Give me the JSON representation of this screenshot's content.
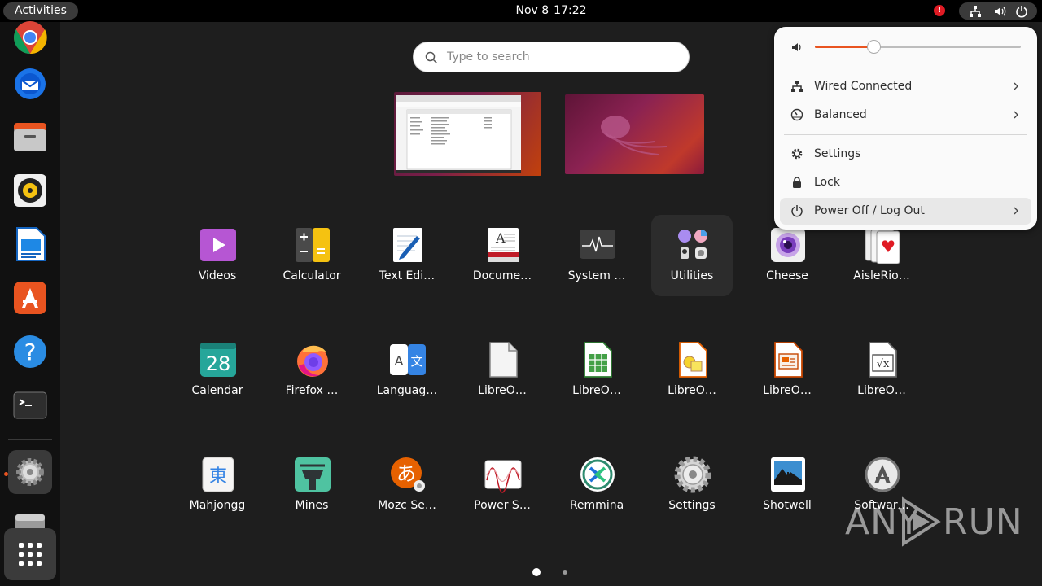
{
  "topbar": {
    "activities_label": "Activities",
    "date": "Nov 8",
    "time": "17:22",
    "notification_badge": "!"
  },
  "search": {
    "placeholder": "Type to search"
  },
  "apps": [
    {
      "name": "videos",
      "label": "Videos",
      "icon": "videos-icon"
    },
    {
      "name": "calculator",
      "label": "Calculator",
      "icon": "calculator-icon"
    },
    {
      "name": "text-editor",
      "label": "Text Edi…",
      "icon": "text-editor-icon"
    },
    {
      "name": "document-viewer",
      "label": "Docume…",
      "icon": "document-viewer-icon"
    },
    {
      "name": "system-monitor",
      "label": "System …",
      "icon": "system-monitor-icon"
    },
    {
      "name": "utilities",
      "label": "Utilities",
      "icon": "utilities-folder-icon",
      "selected": true
    },
    {
      "name": "cheese",
      "label": "Cheese",
      "icon": "cheese-icon"
    },
    {
      "name": "aisleriot",
      "label": "AisleRio…",
      "icon": "cards-icon"
    },
    {
      "name": "calendar",
      "label": "Calendar",
      "icon": "calendar-icon",
      "badge": "28"
    },
    {
      "name": "firefox",
      "label": "Firefox …",
      "icon": "firefox-icon"
    },
    {
      "name": "language",
      "label": "Languag…",
      "icon": "language-icon",
      "glyph_a": "A",
      "glyph_b": "文"
    },
    {
      "name": "libreoffice",
      "label": "LibreO…",
      "icon": "libreoffice-icon"
    },
    {
      "name": "libreoffice-calc",
      "label": "LibreO…",
      "icon": "libreoffice-calc-icon"
    },
    {
      "name": "libreoffice-draw",
      "label": "LibreO…",
      "icon": "libreoffice-draw-icon"
    },
    {
      "name": "libreoffice-impress",
      "label": "LibreO…",
      "icon": "libreoffice-impress-icon"
    },
    {
      "name": "libreoffice-math",
      "label": "LibreO…",
      "icon": "libreoffice-math-icon",
      "glyph": "√x"
    },
    {
      "name": "mahjongg",
      "label": "Mahjongg",
      "icon": "mahjongg-icon",
      "glyph": "東"
    },
    {
      "name": "mines",
      "label": "Mines",
      "icon": "mines-icon"
    },
    {
      "name": "mozc",
      "label": "Mozc Se…",
      "icon": "mozc-icon",
      "glyph": "あ"
    },
    {
      "name": "power-statistics",
      "label": "Power S…",
      "icon": "power-statistics-icon"
    },
    {
      "name": "remmina",
      "label": "Remmina",
      "icon": "remmina-icon"
    },
    {
      "name": "settings",
      "label": "Settings",
      "icon": "settings-icon"
    },
    {
      "name": "shotwell",
      "label": "Shotwell",
      "icon": "shotwell-icon"
    },
    {
      "name": "software",
      "label": "Softwar…",
      "icon": "software-icon"
    }
  ],
  "pagination": {
    "current": 1,
    "total": 2
  },
  "quick_settings": {
    "volume_level": 0.29,
    "network_label": "Wired Connected",
    "power_mode_label": "Balanced",
    "settings_label": "Settings",
    "lock_label": "Lock",
    "power_off_label": "Power Off / Log Out"
  },
  "dock": {
    "items": [
      "chrome-icon",
      "thunderbird-icon",
      "files-icon",
      "rhythmbox-icon",
      "libreoffice-writer-icon",
      "app-center-icon",
      "help-icon",
      "terminal-icon",
      "settings-icon",
      "disk-icon"
    ],
    "show_apps": "show-apps-grid-icon"
  },
  "watermark": {
    "left": "ANY",
    "right": "RUN"
  },
  "colors": {
    "accent": "#e95420",
    "panel_bg": "#000000",
    "overview_bg": "#1e1e1e",
    "menu_bg": "#fafafa"
  }
}
